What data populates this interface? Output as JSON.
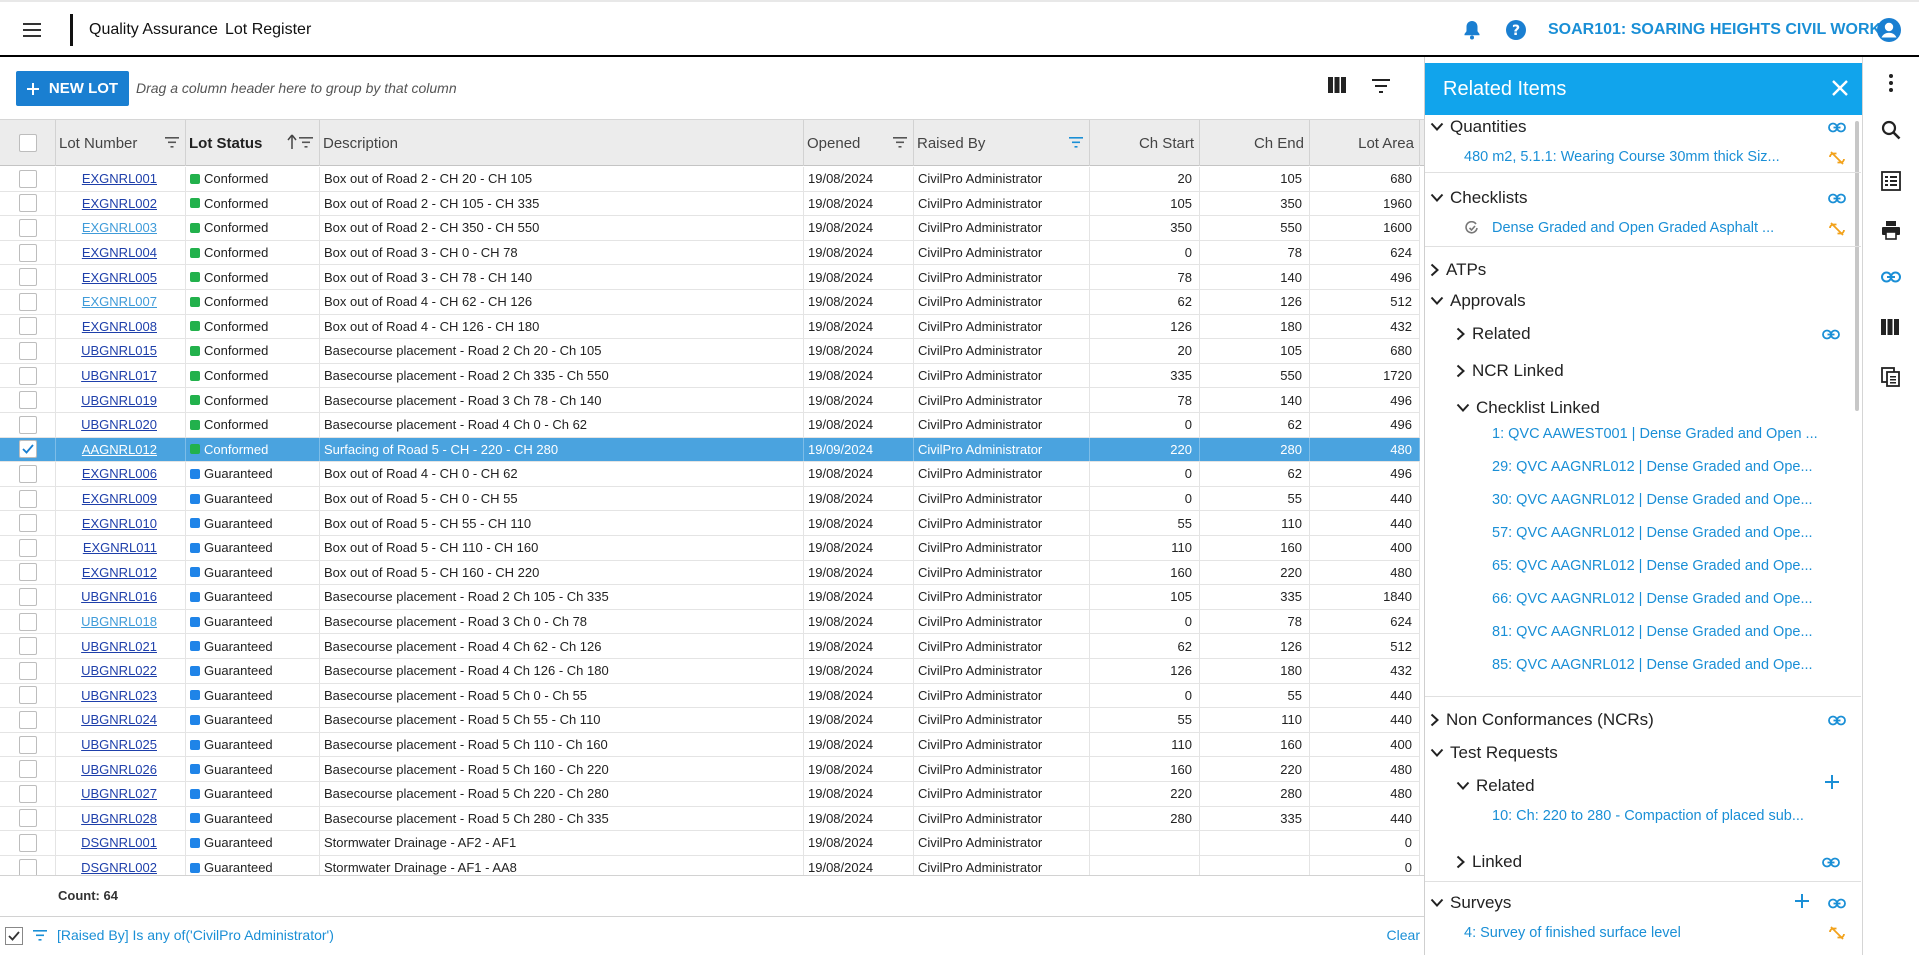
{
  "topbar": {
    "module": "Quality Assurance",
    "page": "Lot Register",
    "project": "SOAR101: SOARING HEIGHTS CIVIL WORKS"
  },
  "toolbar": {
    "new_lot_label": "NEW LOT",
    "group_hint": "Drag a column header here to group by that column"
  },
  "columns": {
    "lot_number": "Lot Number",
    "lot_status": "Lot Status",
    "description": "Description",
    "opened": "Opened",
    "raised_by": "Raised By",
    "ch_start": "Ch Start",
    "ch_end": "Ch End",
    "lot_area": "Lot Area"
  },
  "status_colors": {
    "Conformed": "#22b14c",
    "Guaranteed": "#1f84e8"
  },
  "rows": [
    {
      "lot": "EXGNRL001",
      "status": "Conformed",
      "desc": "Box out of Road 2 - CH 20 - CH 105",
      "opened": "19/08/2024",
      "by": "CivilPro Administrator",
      "start": "20",
      "end": "105",
      "area": "680",
      "visited": false,
      "selected": false
    },
    {
      "lot": "EXGNRL002",
      "status": "Conformed",
      "desc": "Box out of Road 2 - CH 105 - CH 335",
      "opened": "19/08/2024",
      "by": "CivilPro Administrator",
      "start": "105",
      "end": "350",
      "area": "1960",
      "visited": false,
      "selected": false
    },
    {
      "lot": "EXGNRL003",
      "status": "Conformed",
      "desc": "Box out of Road 2 - CH 350 - CH 550",
      "opened": "19/08/2024",
      "by": "CivilPro Administrator",
      "start": "350",
      "end": "550",
      "area": "1600",
      "visited": true,
      "selected": false
    },
    {
      "lot": "EXGNRL004",
      "status": "Conformed",
      "desc": "Box out of Road 3 - CH 0 - CH 78",
      "opened": "19/08/2024",
      "by": "CivilPro Administrator",
      "start": "0",
      "end": "78",
      "area": "624",
      "visited": false,
      "selected": false
    },
    {
      "lot": "EXGNRL005",
      "status": "Conformed",
      "desc": "Box out of Road 3 - CH 78 - CH 140",
      "opened": "19/08/2024",
      "by": "CivilPro Administrator",
      "start": "78",
      "end": "140",
      "area": "496",
      "visited": false,
      "selected": false
    },
    {
      "lot": "EXGNRL007",
      "status": "Conformed",
      "desc": "Box out of Road 4 - CH 62 - CH 126",
      "opened": "19/08/2024",
      "by": "CivilPro Administrator",
      "start": "62",
      "end": "126",
      "area": "512",
      "visited": true,
      "selected": false
    },
    {
      "lot": "EXGNRL008",
      "status": "Conformed",
      "desc": "Box out of Road 4 - CH 126 - CH 180",
      "opened": "19/08/2024",
      "by": "CivilPro Administrator",
      "start": "126",
      "end": "180",
      "area": "432",
      "visited": false,
      "selected": false
    },
    {
      "lot": "UBGNRL015",
      "status": "Conformed",
      "desc": "Basecourse placement - Road 2 Ch 20 - Ch 105",
      "opened": "19/08/2024",
      "by": "CivilPro Administrator",
      "start": "20",
      "end": "105",
      "area": "680",
      "visited": false,
      "selected": false
    },
    {
      "lot": "UBGNRL017",
      "status": "Conformed",
      "desc": "Basecourse placement - Road 2 Ch 335 - Ch 550",
      "opened": "19/08/2024",
      "by": "CivilPro Administrator",
      "start": "335",
      "end": "550",
      "area": "1720",
      "visited": false,
      "selected": false
    },
    {
      "lot": "UBGNRL019",
      "status": "Conformed",
      "desc": "Basecourse placement - Road 3 Ch 78 - Ch 140",
      "opened": "19/08/2024",
      "by": "CivilPro Administrator",
      "start": "78",
      "end": "140",
      "area": "496",
      "visited": false,
      "selected": false
    },
    {
      "lot": "UBGNRL020",
      "status": "Conformed",
      "desc": "Basecourse placement - Road 4 Ch 0 - Ch 62",
      "opened": "19/08/2024",
      "by": "CivilPro Administrator",
      "start": "0",
      "end": "62",
      "area": "496",
      "visited": false,
      "selected": false
    },
    {
      "lot": "AAGNRL012",
      "status": "Conformed",
      "desc": "Surfacing of Road 5 - CH - 220 - CH 280",
      "opened": "19/09/2024",
      "by": "CivilPro Administrator",
      "start": "220",
      "end": "280",
      "area": "480",
      "visited": false,
      "selected": true
    },
    {
      "lot": "EXGNRL006",
      "status": "Guaranteed",
      "desc": "Box out of Road 4 - CH 0 - CH 62",
      "opened": "19/08/2024",
      "by": "CivilPro Administrator",
      "start": "0",
      "end": "62",
      "area": "496",
      "visited": false,
      "selected": false
    },
    {
      "lot": "EXGNRL009",
      "status": "Guaranteed",
      "desc": "Box out of Road 5 - CH 0 - CH 55",
      "opened": "19/08/2024",
      "by": "CivilPro Administrator",
      "start": "0",
      "end": "55",
      "area": "440",
      "visited": false,
      "selected": false
    },
    {
      "lot": "EXGNRL010",
      "status": "Guaranteed",
      "desc": "Box out of Road 5 - CH 55 - CH 110",
      "opened": "19/08/2024",
      "by": "CivilPro Administrator",
      "start": "55",
      "end": "110",
      "area": "440",
      "visited": false,
      "selected": false
    },
    {
      "lot": "EXGNRL011",
      "status": "Guaranteed",
      "desc": "Box out of Road 5 - CH 110 - CH 160",
      "opened": "19/08/2024",
      "by": "CivilPro Administrator",
      "start": "110",
      "end": "160",
      "area": "400",
      "visited": false,
      "selected": false
    },
    {
      "lot": "EXGNRL012",
      "status": "Guaranteed",
      "desc": "Box out of Road 5 - CH 160 - CH 220",
      "opened": "19/08/2024",
      "by": "CivilPro Administrator",
      "start": "160",
      "end": "220",
      "area": "480",
      "visited": false,
      "selected": false
    },
    {
      "lot": "UBGNRL016",
      "status": "Guaranteed",
      "desc": "Basecourse placement - Road 2 Ch 105 - Ch 335",
      "opened": "19/08/2024",
      "by": "CivilPro Administrator",
      "start": "105",
      "end": "335",
      "area": "1840",
      "visited": false,
      "selected": false
    },
    {
      "lot": "UBGNRL018",
      "status": "Guaranteed",
      "desc": "Basecourse placement - Road 3 Ch 0 - Ch 78",
      "opened": "19/08/2024",
      "by": "CivilPro Administrator",
      "start": "0",
      "end": "78",
      "area": "624",
      "visited": true,
      "selected": false
    },
    {
      "lot": "UBGNRL021",
      "status": "Guaranteed",
      "desc": "Basecourse placement - Road 4 Ch 62 - Ch 126",
      "opened": "19/08/2024",
      "by": "CivilPro Administrator",
      "start": "62",
      "end": "126",
      "area": "512",
      "visited": false,
      "selected": false
    },
    {
      "lot": "UBGNRL022",
      "status": "Guaranteed",
      "desc": "Basecourse placement - Road 4 Ch 126 - Ch 180",
      "opened": "19/08/2024",
      "by": "CivilPro Administrator",
      "start": "126",
      "end": "180",
      "area": "432",
      "visited": false,
      "selected": false
    },
    {
      "lot": "UBGNRL023",
      "status": "Guaranteed",
      "desc": "Basecourse placement - Road 5 Ch 0 - Ch 55",
      "opened": "19/08/2024",
      "by": "CivilPro Administrator",
      "start": "0",
      "end": "55",
      "area": "440",
      "visited": false,
      "selected": false
    },
    {
      "lot": "UBGNRL024",
      "status": "Guaranteed",
      "desc": "Basecourse placement - Road 5 Ch 55 - Ch 110",
      "opened": "19/08/2024",
      "by": "CivilPro Administrator",
      "start": "55",
      "end": "110",
      "area": "440",
      "visited": false,
      "selected": false
    },
    {
      "lot": "UBGNRL025",
      "status": "Guaranteed",
      "desc": "Basecourse placement - Road 5 Ch 110 - Ch 160",
      "opened": "19/08/2024",
      "by": "CivilPro Administrator",
      "start": "110",
      "end": "160",
      "area": "400",
      "visited": false,
      "selected": false
    },
    {
      "lot": "UBGNRL026",
      "status": "Guaranteed",
      "desc": "Basecourse placement - Road 5 Ch 160 - Ch 220",
      "opened": "19/08/2024",
      "by": "CivilPro Administrator",
      "start": "160",
      "end": "220",
      "area": "480",
      "visited": false,
      "selected": false
    },
    {
      "lot": "UBGNRL027",
      "status": "Guaranteed",
      "desc": "Basecourse placement - Road 5 Ch 220 - Ch 280",
      "opened": "19/08/2024",
      "by": "CivilPro Administrator",
      "start": "220",
      "end": "280",
      "area": "480",
      "visited": false,
      "selected": false
    },
    {
      "lot": "UBGNRL028",
      "status": "Guaranteed",
      "desc": "Basecourse placement - Road 5 Ch 280 - Ch 335",
      "opened": "19/08/2024",
      "by": "CivilPro Administrator",
      "start": "280",
      "end": "335",
      "area": "440",
      "visited": false,
      "selected": false
    },
    {
      "lot": "DSGNRL001",
      "status": "Guaranteed",
      "desc": "Stormwater Drainage - AF2 - AF1",
      "opened": "19/08/2024",
      "by": "CivilPro Administrator",
      "start": "",
      "end": "",
      "area": "0",
      "visited": false,
      "selected": false
    },
    {
      "lot": "DSGNRL002",
      "status": "Guaranteed",
      "desc": "Stormwater Drainage - AF1 - AA8",
      "opened": "19/08/2024",
      "by": "CivilPro Administrator",
      "start": "",
      "end": "",
      "area": "0",
      "visited": false,
      "selected": false
    }
  ],
  "footer": {
    "count_label": "Count: 64",
    "filter_text": "[Raised By] Is any of('CivilPro Administrator')",
    "clear_label": "Clear"
  },
  "panel": {
    "title": "Related Items",
    "quantities": {
      "label": "Quantities",
      "item": "480 m2, 5.1.1: Wearing Course 30mm thick Siz..."
    },
    "checklists": {
      "label": "Checklists",
      "item": "Dense Graded and Open Graded Asphalt ..."
    },
    "atps": {
      "label": "ATPs"
    },
    "approvals": {
      "label": "Approvals",
      "related": "Related",
      "ncr_linked": "NCR Linked",
      "checklist_linked": "Checklist Linked",
      "items": [
        "1: QVC AAWEST001 | Dense Graded and Open ...",
        "29: QVC AAGNRL012 | Dense Graded and Ope...",
        "30: QVC AAGNRL012 | Dense Graded and Ope...",
        "57: QVC AAGNRL012 | Dense Graded and Ope...",
        "65: QVC AAGNRL012 | Dense Graded and Ope...",
        "66: QVC AAGNRL012 | Dense Graded and Ope...",
        "81: QVC AAGNRL012 | Dense Graded and Ope...",
        "85: QVC AAGNRL012 | Dense Graded and Ope..."
      ]
    },
    "ncrs": {
      "label": "Non Conformances (NCRs)"
    },
    "test_requests": {
      "label": "Test Requests",
      "related": "Related",
      "item": "10: Ch: 220 to 280 - Compaction of placed sub...",
      "linked": "Linked"
    },
    "surveys": {
      "label": "Surveys",
      "item": "4: Survey of finished surface level"
    }
  },
  "colors": {
    "accent": "#1a8fd6",
    "panel_header": "#11a4ec",
    "selected_row": "#4aa3df",
    "unlink": "#f2a21b"
  }
}
